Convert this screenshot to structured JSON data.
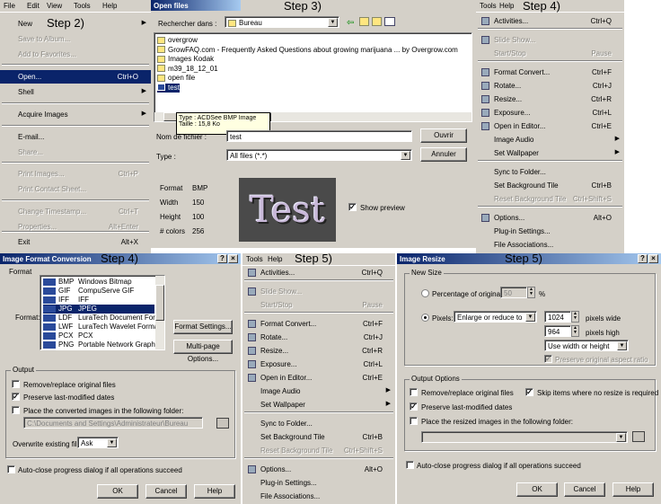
{
  "steps": {
    "s2": "Step 2)",
    "s3": "Step 3)",
    "s4a": "Step 4)",
    "s4b": "Step 4)",
    "s5a": "Step 5)",
    "s5b": "Step 5)"
  },
  "file_panel": {
    "menubar": [
      "File",
      "Edit",
      "View",
      "Tools",
      "Help"
    ],
    "items": [
      {
        "label": "New",
        "shortcut": "",
        "arrow": true,
        "state": "normal"
      },
      {
        "label": "Save to Album...",
        "shortcut": "",
        "arrow": false,
        "state": "disabled"
      },
      {
        "label": "Add to Favorites...",
        "shortcut": "",
        "arrow": false,
        "state": "disabled"
      },
      {
        "label": "Open...",
        "shortcut": "Ctrl+O",
        "arrow": false,
        "state": "selected"
      },
      {
        "label": "Shell",
        "shortcut": "",
        "arrow": true,
        "state": "normal"
      },
      {
        "label": "Acquire Images",
        "shortcut": "",
        "arrow": true,
        "state": "normal"
      },
      {
        "label": "E-mail...",
        "shortcut": "",
        "arrow": false,
        "state": "normal"
      },
      {
        "label": "Share...",
        "shortcut": "",
        "arrow": false,
        "state": "disabled"
      },
      {
        "label": "Print Images...",
        "shortcut": "Ctrl+P",
        "arrow": false,
        "state": "disabled"
      },
      {
        "label": "Print Contact Sheet...",
        "shortcut": "",
        "arrow": false,
        "state": "disabled"
      },
      {
        "label": "Change Timestamp...",
        "shortcut": "Ctrl+T",
        "arrow": false,
        "state": "disabled"
      },
      {
        "label": "Properties...",
        "shortcut": "Alt+Enter",
        "arrow": false,
        "state": "disabled"
      },
      {
        "label": "Exit",
        "shortcut": "Alt+X",
        "arrow": false,
        "state": "normal"
      }
    ]
  },
  "open_dialog": {
    "title": "Open files",
    "look_in_label": "Rechercher dans :",
    "look_in_value": "Bureau",
    "files": [
      "overgrow",
      "GrowFAQ.com - Frequently Asked Questions about growing marijuana ... by Overgrow.com",
      "Images Kodak",
      "m39_18_12_01",
      "open file",
      "test"
    ],
    "tooltip_type": "Type : ACDSee BMP Image",
    "tooltip_size": "Taille : 15,8 Ko",
    "filename_label": "Nom de fichier :",
    "filename_value": "test",
    "type_label": "Type :",
    "type_value": "All files (*.*)",
    "open_button": "Ouvrir",
    "cancel_button": "Annuler",
    "info": [
      {
        "k": "Format",
        "v": "BMP"
      },
      {
        "k": "Width",
        "v": "150"
      },
      {
        "k": "Height",
        "v": "100"
      },
      {
        "k": "# colors",
        "v": "256"
      }
    ],
    "preview_text": "Test",
    "show_preview": "Show preview"
  },
  "tools_menu": {
    "menubar": [
      "Tools",
      "Help"
    ],
    "items": [
      {
        "label": "Activities...",
        "shortcut": "Ctrl+Q",
        "arrow": false,
        "state": "normal",
        "icon": true
      },
      {
        "label": "Slide Show...",
        "shortcut": "",
        "arrow": false,
        "state": "disabled",
        "icon": true
      },
      {
        "label": "Start/Stop",
        "shortcut": "Pause",
        "arrow": false,
        "state": "disabled",
        "icon": false
      },
      {
        "label": "Format Convert...",
        "shortcut": "Ctrl+F",
        "arrow": false,
        "state": "normal",
        "icon": true
      },
      {
        "label": "Rotate...",
        "shortcut": "Ctrl+J",
        "arrow": false,
        "state": "normal",
        "icon": true
      },
      {
        "label": "Resize...",
        "shortcut": "Ctrl+R",
        "arrow": false,
        "state": "normal",
        "icon": true
      },
      {
        "label": "Exposure...",
        "shortcut": "Ctrl+L",
        "arrow": false,
        "state": "normal",
        "icon": true
      },
      {
        "label": "Open in Editor...",
        "shortcut": "Ctrl+E",
        "arrow": false,
        "state": "normal",
        "icon": true
      },
      {
        "label": "Image Audio",
        "shortcut": "",
        "arrow": true,
        "state": "normal",
        "icon": false
      },
      {
        "label": "Set Wallpaper",
        "shortcut": "",
        "arrow": true,
        "state": "normal",
        "icon": false
      },
      {
        "label": "Sync to Folder...",
        "shortcut": "",
        "arrow": false,
        "state": "normal",
        "icon": false
      },
      {
        "label": "Set Background Tile",
        "shortcut": "Ctrl+B",
        "arrow": false,
        "state": "normal",
        "icon": false
      },
      {
        "label": "Reset Background Tile",
        "shortcut": "Ctrl+Shift+S",
        "arrow": false,
        "state": "disabled",
        "icon": false
      },
      {
        "label": "Options...",
        "shortcut": "Alt+O",
        "arrow": false,
        "state": "normal",
        "icon": true
      },
      {
        "label": "Plug-in Settings...",
        "shortcut": "",
        "arrow": false,
        "state": "normal",
        "icon": false
      },
      {
        "label": "File Associations...",
        "shortcut": "",
        "arrow": false,
        "state": "normal",
        "icon": false
      }
    ]
  },
  "ifc": {
    "title": "Image Format Conversion",
    "format_group": "Format",
    "format_label": "Format:",
    "formats": [
      {
        "code": "BMP",
        "desc": "Windows Bitmap"
      },
      {
        "code": "GIF",
        "desc": "CompuServe GIF"
      },
      {
        "code": "IFF",
        "desc": "IFF"
      },
      {
        "code": "JPG",
        "desc": "JPEG"
      },
      {
        "code": "LDF",
        "desc": "LuraTech Document Format"
      },
      {
        "code": "LWF",
        "desc": "LuraTech Wavelet Format"
      },
      {
        "code": "PCX",
        "desc": "PCX"
      },
      {
        "code": "PNG",
        "desc": "Portable Network Graphics"
      }
    ],
    "format_settings": "Format Settings...",
    "multipage": "Multi-page Options...",
    "output_group": "Output",
    "opt_remove": "Remove/replace original files",
    "opt_preserve": "Preserve last-modified dates",
    "opt_place": "Place the converted images in the following folder:",
    "folder_value": "C:\\Documents and Settings\\Administrateur\\Bureau",
    "overwrite_label": "Overwrite existing files:",
    "overwrite_value": "Ask",
    "auto_close": "Auto-close progress dialog if all operations succeed",
    "ok": "OK",
    "cancel": "Cancel",
    "help": "Help"
  },
  "resize": {
    "title": "Image Resize",
    "new_size_group": "New Size",
    "pct_label": "Percentage of original:",
    "pct_value": "50",
    "pct_unit": "%",
    "pixels_label": "Pixels:",
    "pixels_mode": "Enlarge or reduce to",
    "width_value": "1024",
    "width_unit": "pixels wide",
    "height_value": "964",
    "height_unit": "pixels high",
    "fit_mode": "Use width or height",
    "preserve_aspect": "Preserve original aspect ratio",
    "output_group": "Output Options",
    "opt_remove": "Remove/replace original files",
    "opt_skip": "Skip items where no resize is required",
    "opt_preserve": "Preserve last-modified dates",
    "opt_place": "Place the resized images in the following folder:",
    "auto_close": "Auto-close progress dialog if all operations succeed",
    "ok": "OK",
    "cancel": "Cancel",
    "help": "Help"
  }
}
